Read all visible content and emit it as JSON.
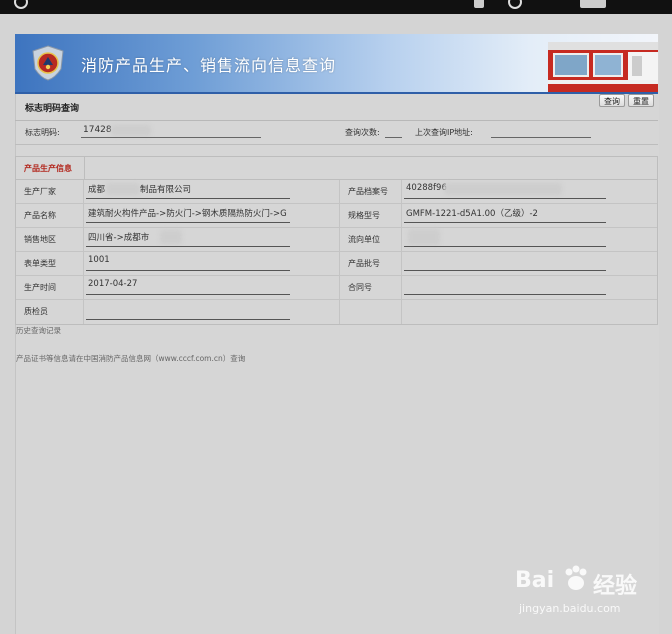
{
  "banner": {
    "title": "消防产品生产、销售流向信息查询"
  },
  "section": {
    "label": "标志明码查询",
    "query_button": "查询",
    "reset_button": "重置"
  },
  "query": {
    "code_label": "标志明码:",
    "code_value": "17428",
    "count_label": "查询次数:",
    "count_value": "",
    "last_ip_label": "上次查询IP地址:",
    "last_ip_value": ""
  },
  "info": {
    "title": "产品生产信息",
    "rows": [
      {
        "l1": "生产厂家",
        "v1": "成都",
        "v1b": "制品有限公司",
        "l2": "产品档案号",
        "v2": "40288f96"
      },
      {
        "l1": "产品名称",
        "v1": "建筑耐火构件产品->防火门->钢木质隔热防火门->G",
        "l2": "规格型号",
        "v2": "GMFM-1221-d5A1.00（乙级）-2"
      },
      {
        "l1": "销售地区",
        "v1": "四川省->成都市",
        "l2": "流向单位",
        "v2": ""
      },
      {
        "l1": "表单类型",
        "v1": "1001",
        "l2": "产品批号",
        "v2": ""
      },
      {
        "l1": "生产时间",
        "v1": "2017-04-27",
        "l2": "合同号",
        "v2": ""
      },
      {
        "l1": "质检员",
        "v1": "",
        "l2": "",
        "v2": ""
      }
    ]
  },
  "footer": {
    "history": "历史查询记录",
    "note": "产品证书等信息请在中国消防产品信息网（www.cccf.com.cn）查询"
  },
  "watermark": {
    "brand": "Bai",
    "brand2": "经验",
    "url": "jingyan.baidu.com"
  }
}
